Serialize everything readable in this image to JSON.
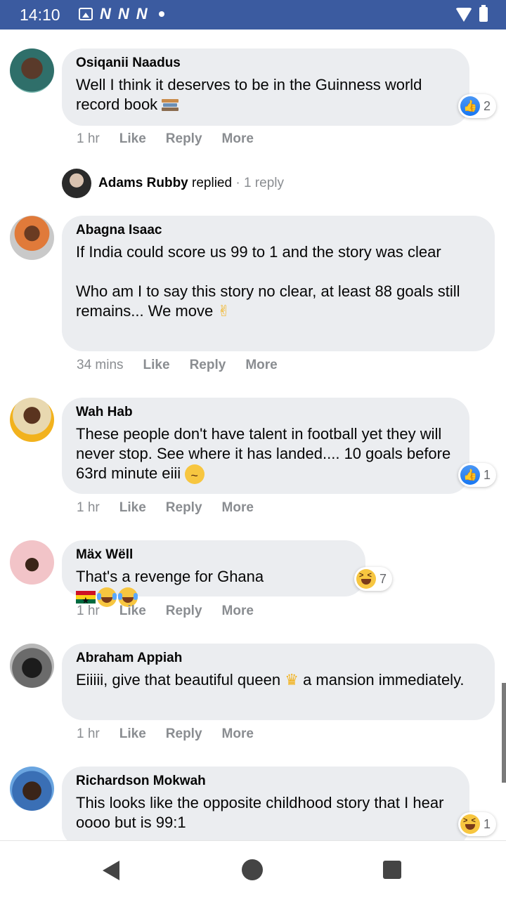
{
  "status_bar": {
    "time": "14:10",
    "n_icons": [
      "N",
      "N",
      "N"
    ]
  },
  "comments": [
    {
      "name": "Osiqanii Naadus",
      "text": "Well I think it deserves to be in the Guinness world record book",
      "time": "1 hr",
      "reaction": "like",
      "reaction_count": "2"
    },
    {
      "name": "Abagna Isaac",
      "text_1": "If India could score us 99 to 1 and the story was clear",
      "text_2": "Who am I to say this story no clear, at least 88 goals still remains... We move",
      "time": "34 mins"
    },
    {
      "name": "Wah Hab",
      "text": "These people don't have talent in football yet they will never stop. See where it has landed.... 10 goals before 63rd minute eiii",
      "time": "1 hr",
      "reaction": "like",
      "reaction_count": "1"
    },
    {
      "name": "Mäx Wëll",
      "text": "That's a revenge for Ghana",
      "time": "1 hr",
      "reaction": "haha",
      "reaction_count": "7"
    },
    {
      "name": "Abraham Appiah",
      "text_1": "Eiiiii, give that beautiful queen",
      "text_2": "a mansion immediately.",
      "time": "1 hr"
    },
    {
      "name": "Richardson Mokwah",
      "text": "This looks like the opposite childhood story that I hear oooo but is 99:1",
      "reaction": "haha",
      "reaction_count": "1"
    }
  ],
  "actions": {
    "like": "Like",
    "reply": "Reply",
    "more": "More"
  },
  "reply_thread": {
    "name": "Adams Rubby",
    "verb": "replied",
    "meta": "· 1 reply"
  },
  "colors": {
    "status_bar": "#3b5ba0",
    "bubble": "#ebedf0",
    "like_blue": "#1877f2",
    "meta_gray": "#8a8d91"
  }
}
